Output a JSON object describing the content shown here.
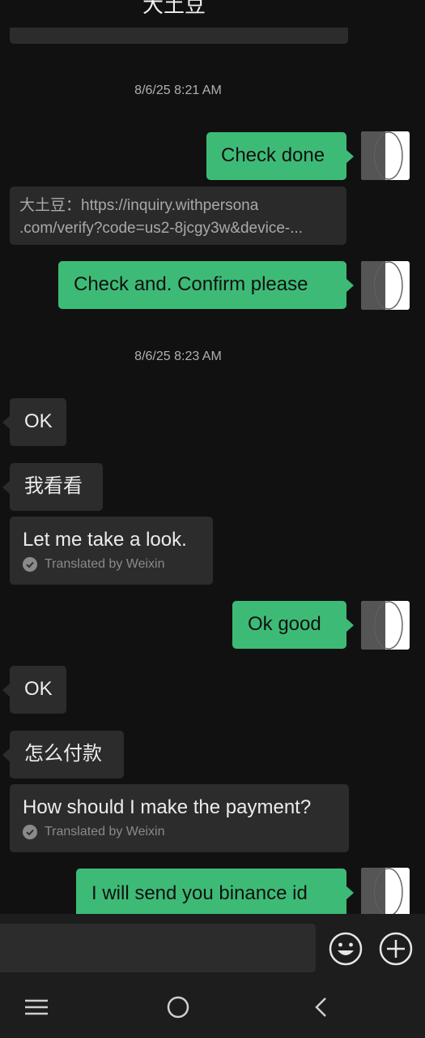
{
  "header": {
    "title": "大土豆",
    "more_icon": "more-dots-icon"
  },
  "messages": {
    "ts1": "8/6/25 8:21 AM",
    "m1": "Check done",
    "quote_line1": "大土豆：https://inquiry.withpersona",
    "quote_line2": ".com/verify?code=us2-8jcgy3w&device-...",
    "m2": "Check and. Confirm please",
    "ts2": "8/6/25 8:23 AM",
    "m3": "OK",
    "m4": "我看看",
    "m4_translation": "Let me take a look.",
    "translated_by": "Translated by Weixin",
    "m5": "Ok good",
    "m6": "OK",
    "m7": "怎么付款",
    "m7_translation": "How should I make the payment?",
    "m8": "I will send you binance id"
  },
  "input": {
    "value": "",
    "emoji_icon": "emoji-icon",
    "plus_icon": "plus-circle-icon"
  },
  "nav": {
    "menu_icon": "recent-apps-icon",
    "home_icon": "home-icon",
    "back_icon": "back-icon"
  },
  "colors": {
    "outgoing_bubble": "#3dbb76",
    "incoming_bubble": "#2c2c2c",
    "background": "#111111"
  }
}
